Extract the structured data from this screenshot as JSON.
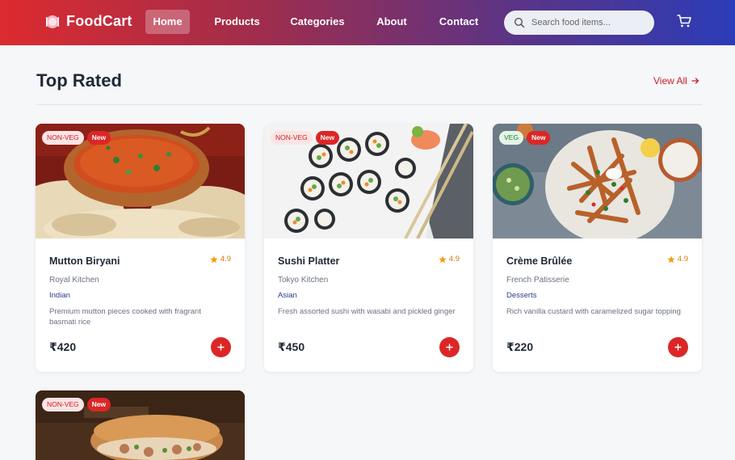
{
  "brand": {
    "name": "FoodCart",
    "icon": "plate-icon"
  },
  "nav": {
    "items": [
      {
        "label": "Home",
        "active": true
      },
      {
        "label": "Products",
        "active": false
      },
      {
        "label": "Categories",
        "active": false
      },
      {
        "label": "About",
        "active": false
      },
      {
        "label": "Contact",
        "active": false
      }
    ]
  },
  "search": {
    "placeholder": "Search food items...",
    "value": "",
    "icon": "search-icon"
  },
  "cart": {
    "icon": "cart-icon"
  },
  "section": {
    "title": "Top Rated",
    "view_all": "View All"
  },
  "colors": {
    "accent": "#dc2626",
    "nav_start": "#dc2b2f",
    "nav_end": "#2b3cb8",
    "rating": "#d97706"
  },
  "cards": [
    {
      "diet": "NON-VEG",
      "tag": "New",
      "name": "Mutton Biryani",
      "rating": "4.9",
      "restaurant": "Royal Kitchen",
      "cuisine": "Indian",
      "description": "Premium mutton pieces cooked with fragrant basmati rice",
      "price": "₹420"
    },
    {
      "diet": "NON-VEG",
      "tag": "New",
      "name": "Sushi Platter",
      "rating": "4.9",
      "restaurant": "Tokyo Kitchen",
      "cuisine": "Asian",
      "description": "Fresh assorted sushi with wasabi and pickled ginger",
      "price": "₹450"
    },
    {
      "diet": "VEG",
      "tag": "New",
      "name": "Crème Brûlée",
      "rating": "4.9",
      "restaurant": "French Patisserie",
      "cuisine": "Desserts",
      "description": "Rich vanilla custard with caramelized sugar topping",
      "price": "₹220"
    },
    {
      "diet": "NON-VEG",
      "tag": "New"
    }
  ]
}
